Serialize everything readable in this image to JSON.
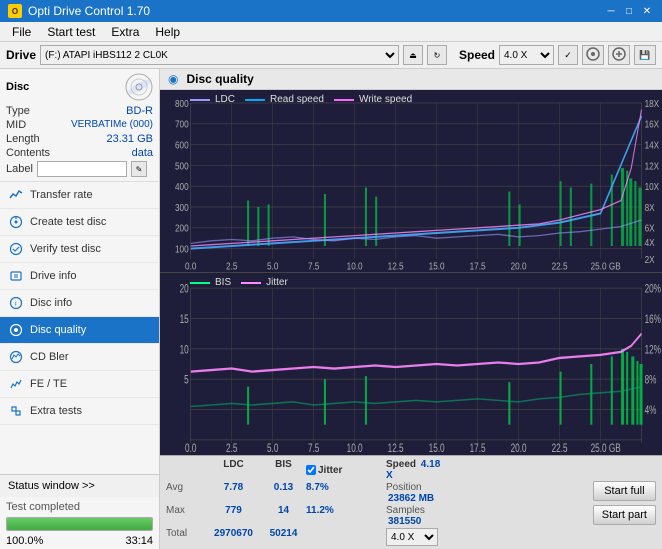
{
  "titleBar": {
    "appName": "Opti Drive Control 1.70",
    "minBtn": "─",
    "maxBtn": "□",
    "closeBtn": "✕"
  },
  "menuBar": {
    "items": [
      "File",
      "Start test",
      "Extra",
      "Help"
    ]
  },
  "topBar": {
    "driveLabel": "Drive",
    "driveValue": "(F:) ATAPI iHBS112  2 CL0K",
    "speedLabel": "Speed",
    "speedValue": "4.0 X"
  },
  "disc": {
    "title": "Disc",
    "typeLabel": "Type",
    "typeValue": "BD-R",
    "midLabel": "MID",
    "midValue": "VERBATIMe (000)",
    "lengthLabel": "Length",
    "lengthValue": "23.31 GB",
    "contentsLabel": "Contents",
    "contentsValue": "data",
    "labelLabel": "Label"
  },
  "nav": {
    "items": [
      {
        "id": "transfer-rate",
        "label": "Transfer rate",
        "icon": "chart"
      },
      {
        "id": "create-test-disc",
        "label": "Create test disc",
        "icon": "disc"
      },
      {
        "id": "verify-test-disc",
        "label": "Verify test disc",
        "icon": "check"
      },
      {
        "id": "drive-info",
        "label": "Drive info",
        "icon": "info"
      },
      {
        "id": "disc-info",
        "label": "Disc info",
        "icon": "disc-info"
      },
      {
        "id": "disc-quality",
        "label": "Disc quality",
        "icon": "quality",
        "active": true
      },
      {
        "id": "cd-bler",
        "label": "CD Bler",
        "icon": "cd"
      },
      {
        "id": "fe-te",
        "label": "FE / TE",
        "icon": "fe"
      },
      {
        "id": "extra-tests",
        "label": "Extra tests",
        "icon": "extra"
      }
    ]
  },
  "statusWindow": {
    "label": "Status window >>",
    "statusText": "Test completed",
    "progressPercent": 100,
    "progressLabel": "100.0%",
    "timeLabel": "33:14"
  },
  "chartHeader": {
    "title": "Disc quality"
  },
  "topChart": {
    "legend": [
      {
        "label": "LDC",
        "color": "#8888ff"
      },
      {
        "label": "Read speed",
        "color": "#00aaff"
      },
      {
        "label": "Write speed",
        "color": "#ff66ff"
      }
    ],
    "yAxisMax": 800,
    "yAxisRight": [
      "18X",
      "16X",
      "14X",
      "12X",
      "10X",
      "8X",
      "6X",
      "4X",
      "2X"
    ],
    "xAxisLabels": [
      "0.0",
      "2.5",
      "5.0",
      "7.5",
      "10.0",
      "12.5",
      "15.0",
      "17.5",
      "20.0",
      "22.5",
      "25.0 GB"
    ]
  },
  "bottomChart": {
    "legend": [
      {
        "label": "BIS",
        "color": "#00ff88"
      },
      {
        "label": "Jitter",
        "color": "#ff88ff"
      }
    ],
    "yAxisMax": 20,
    "yAxisRightLabels": [
      "20%",
      "16%",
      "12%",
      "8%",
      "4%"
    ],
    "xAxisLabels": [
      "0.0",
      "2.5",
      "5.0",
      "7.5",
      "10.0",
      "12.5",
      "15.0",
      "17.5",
      "20.0",
      "22.5",
      "25.0 GB"
    ]
  },
  "stats": {
    "headers": [
      "LDC",
      "BIS",
      "Jitter",
      "Speed",
      ""
    ],
    "avgLabel": "Avg",
    "avgLdc": "7.78",
    "avgBis": "0.13",
    "avgJitter": "8.7%",
    "maxLabel": "Max",
    "maxLdc": "779",
    "maxBis": "14",
    "maxJitter": "11.2%",
    "totalLabel": "Total",
    "totalLdc": "2970670",
    "totalBis": "50214",
    "jitterChecked": true,
    "speedLabel": "Speed",
    "speedValue": "4.18 X",
    "speedSelect": "4.0 X",
    "positionLabel": "Position",
    "positionValue": "23862 MB",
    "samplesLabel": "Samples",
    "samplesValue": "381550"
  },
  "buttons": {
    "startFull": "Start full",
    "startPart": "Start part"
  }
}
